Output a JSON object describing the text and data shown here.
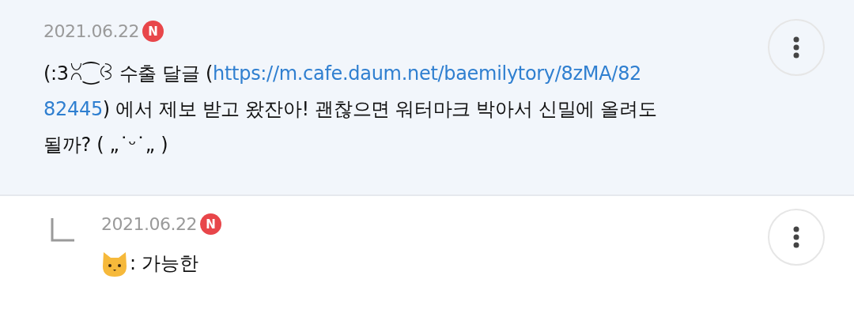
{
  "comments": [
    {
      "kind": "comment",
      "date": "2021.06.22",
      "new_badge": "N",
      "lines": [
        [
          {
            "kind": "plain",
            "text": "(:3ꇤ⁐ꃳ 수출 달글 ("
          },
          {
            "kind": "link",
            "text": "https://m.cafe.daum.net/baemilytory/8zMA/82"
          }
        ],
        [
          {
            "kind": "link",
            "text": "82445"
          },
          {
            "kind": "plain",
            "text": ") 에서 제보 받고 왔잔아! 괜찮으면 워터마크 박아서 신밀에 올려도"
          }
        ],
        [
          {
            "kind": "plain",
            "text": "될까? ( „˙ᵕ˙„ )"
          }
        ]
      ]
    },
    {
      "kind": "reply",
      "date": "2021.06.22",
      "new_badge": "N",
      "lines": [
        [
          {
            "kind": "cat"
          },
          {
            "kind": "plain",
            "text": ": 가능한"
          }
        ]
      ]
    }
  ]
}
